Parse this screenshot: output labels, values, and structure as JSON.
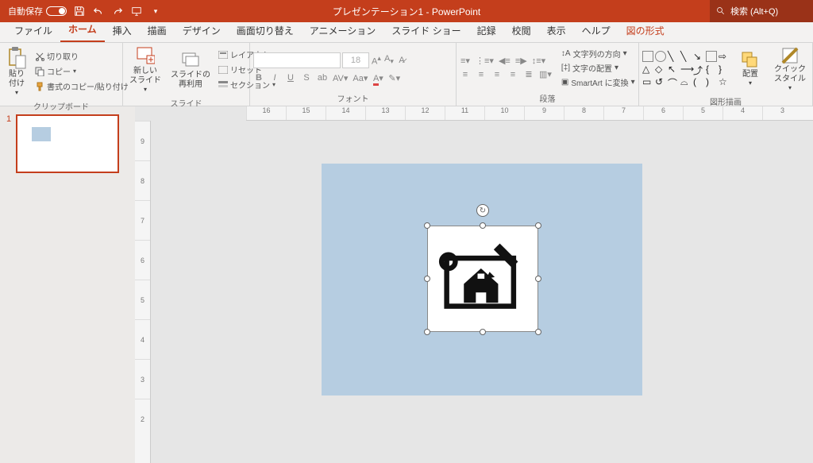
{
  "title": "プレゼンテーション1 - PowerPoint",
  "autosave_label": "自動保存",
  "autosave_state": "オフ",
  "search_placeholder": "検索 (Alt+Q)",
  "tabs": [
    "ファイル",
    "ホーム",
    "挿入",
    "描画",
    "デザイン",
    "画面切り替え",
    "アニメーション",
    "スライド ショー",
    "記録",
    "校閲",
    "表示",
    "ヘルプ",
    "図の形式"
  ],
  "active_tab_index": 1,
  "clipboard": {
    "paste": "貼り付け",
    "cut": "切り取り",
    "copy": "コピー",
    "format_painter": "書式のコピー/貼り付け",
    "group_label": "クリップボード"
  },
  "slides": {
    "new_slide": "新しい\nスライド",
    "reuse": "スライドの\n再利用",
    "layout": "レイアウト",
    "reset": "リセット",
    "section": "セクション",
    "group_label": "スライド"
  },
  "font": {
    "size": "18",
    "group_label": "フォント"
  },
  "paragraph": {
    "text_direction": "文字列の方向",
    "align_text": "文字の配置",
    "smartart": "SmartArt に変換",
    "group_label": "段落"
  },
  "drawing": {
    "arrange": "配置",
    "quick_styles": "クイック\nスタイル",
    "group_label": "図形描画"
  },
  "thumb": {
    "num": "1"
  },
  "hruler": [
    "16",
    "15",
    "14",
    "13",
    "12",
    "11",
    "10",
    "9",
    "8",
    "7",
    "6",
    "5",
    "4",
    "3"
  ],
  "vruler": [
    "9",
    "8",
    "7",
    "6",
    "5",
    "4",
    "3",
    "2"
  ]
}
